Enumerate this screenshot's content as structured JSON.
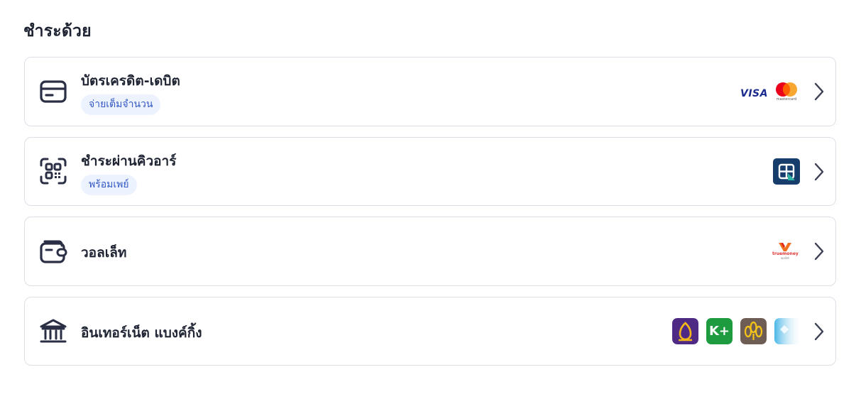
{
  "heading": "ชำระด้วย",
  "methods": [
    {
      "title": "บัตรเครดิต-เดบิต",
      "badge": "จ่ายเต็มจำนวน",
      "icon": "credit-card-icon",
      "brands": [
        {
          "name": "visa-logo",
          "label": "VISA"
        },
        {
          "name": "mastercard-logo",
          "label": "mastercard"
        }
      ]
    },
    {
      "title": "ชำระผ่านคิวอาร์",
      "badge": "พร้อมเพย์",
      "icon": "qr-scan-icon",
      "brands": [
        {
          "name": "thai-qr-payment-logo"
        }
      ]
    },
    {
      "title": "วอลเล็ท",
      "icon": "wallet-icon",
      "brands": [
        {
          "name": "truemoney-wallet-logo",
          "label": "truemoney",
          "sublabel": "wallet"
        }
      ]
    },
    {
      "title": "อินเทอร์เน็ต แบงค์กิ้ง",
      "icon": "bank-icon",
      "brands": [
        {
          "name": "scb-logo",
          "color": "#4e2a84"
        },
        {
          "name": "kplus-logo",
          "label": "K+",
          "color": "#1e9b3e"
        },
        {
          "name": "krungsri-logo",
          "color": "#6e5d55"
        },
        {
          "name": "ktb-logo",
          "color": "#1aa4e0"
        }
      ]
    }
  ]
}
